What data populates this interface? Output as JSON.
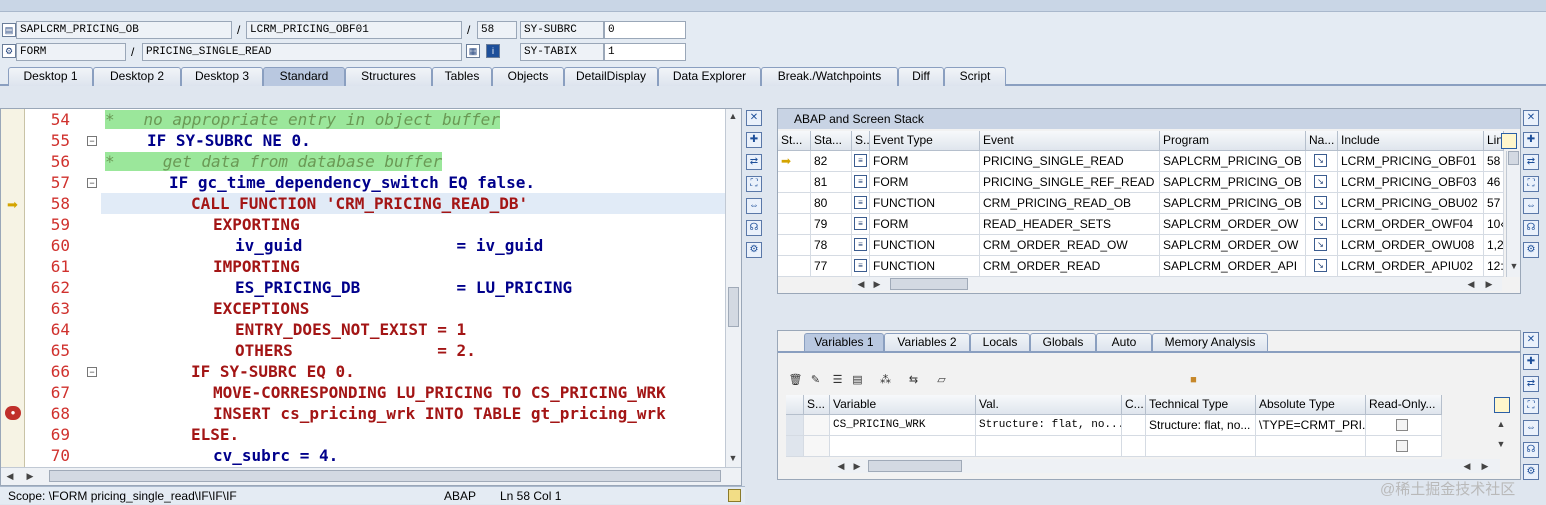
{
  "header": {
    "program": "SAPLCRM_PRICING_OB",
    "include": "LCRM_PRICING_OBF01",
    "line": "58",
    "subrc_label": "SY-SUBRC",
    "subrc_value": "0",
    "event_type": "FORM",
    "event": "PRICING_SINGLE_READ",
    "tabix_label": "SY-TABIX",
    "tabix_value": "1",
    "slash": "/"
  },
  "tabs": [
    "Desktop 1",
    "Desktop 2",
    "Desktop 3",
    "Standard",
    "Structures",
    "Tables",
    "Objects",
    "DetailDisplay",
    "Data Explorer",
    "Break./Watchpoints",
    "Diff",
    "Script"
  ],
  "editor": {
    "lines": [
      {
        "n": "54",
        "c": "*   no appropriate entry in object buffer"
      },
      {
        "n": "55",
        "c": "IF SY-SUBRC NE 0."
      },
      {
        "n": "56",
        "c": "*     get data from database buffer"
      },
      {
        "n": "57",
        "c": "IF gc_time_dependency_switch EQ false."
      },
      {
        "n": "58",
        "c": "CALL FUNCTION 'CRM_PRICING_READ_DB'"
      },
      {
        "n": "59",
        "c": "EXPORTING"
      },
      {
        "n": "60",
        "c": "iv_guid                = iv_guid"
      },
      {
        "n": "61",
        "c": "IMPORTING"
      },
      {
        "n": "62",
        "c": "ES_PRICING_DB          = LU_PRICING"
      },
      {
        "n": "63",
        "c": "EXCEPTIONS"
      },
      {
        "n": "64",
        "c": "ENTRY_DOES_NOT_EXIST = 1"
      },
      {
        "n": "65",
        "c": "OTHERS               = 2."
      },
      {
        "n": "66",
        "c": "IF SY-SUBRC EQ 0."
      },
      {
        "n": "67",
        "c": "MOVE-CORRESPONDING LU_PRICING TO CS_PRICING_WRK"
      },
      {
        "n": "68",
        "c": "INSERT cs_pricing_wrk INTO TABLE gt_pricing_wrk"
      },
      {
        "n": "69",
        "c": "ELSE."
      },
      {
        "n": "70",
        "c": "cv_subrc = 4."
      }
    ]
  },
  "status": {
    "scope": "Scope: \\FORM pricing_single_read\\IF\\IF\\IF",
    "lang": "ABAP",
    "pos": "Ln   58 Col   1"
  },
  "stack": {
    "title": "ABAP and Screen Stack",
    "columns": [
      "St...",
      "Sta...",
      "S..",
      "Event Type",
      "Event",
      "Program",
      "Na...",
      "Include",
      "Lin"
    ],
    "rows": [
      {
        "level": "82",
        "type": "FORM",
        "event": "PRICING_SINGLE_READ",
        "program": "SAPLCRM_PRICING_OB",
        "include": "LCRM_PRICING_OBF01",
        "line": "58",
        "current": true
      },
      {
        "level": "81",
        "type": "FORM",
        "event": "PRICING_SINGLE_REF_READ",
        "program": "SAPLCRM_PRICING_OB",
        "include": "LCRM_PRICING_OBF03",
        "line": "46",
        "current": false
      },
      {
        "level": "80",
        "type": "FUNCTION",
        "event": "CRM_PRICING_READ_OB",
        "program": "SAPLCRM_PRICING_OB",
        "include": "LCRM_PRICING_OBU02",
        "line": "57",
        "current": false
      },
      {
        "level": "79",
        "type": "FORM",
        "event": "READ_HEADER_SETS",
        "program": "SAPLCRM_ORDER_OW",
        "include": "LCRM_ORDER_OWF04",
        "line": "10‹",
        "current": false
      },
      {
        "level": "78",
        "type": "FUNCTION",
        "event": "CRM_ORDER_READ_OW",
        "program": "SAPLCRM_ORDER_OW",
        "include": "LCRM_ORDER_OWU08",
        "line": "1,2",
        "current": false
      },
      {
        "level": "77",
        "type": "FUNCTION",
        "event": "CRM_ORDER_READ",
        "program": "SAPLCRM_ORDER_API",
        "include": "LCRM_ORDER_APIU02",
        "line": "12:",
        "current": false
      }
    ]
  },
  "variables": {
    "tabs": [
      "Variables 1",
      "Variables 2",
      "Locals",
      "Globals",
      "Auto",
      "Memory Analysis"
    ],
    "columns": [
      "S...",
      "Variable",
      "Val.",
      "C...",
      "Technical Type",
      "Absolute Type",
      "Read-Only..."
    ],
    "rows": [
      {
        "variable": "CS_PRICING_WRK",
        "value": "Structure: flat, no...",
        "technical": "Structure: flat, no...",
        "absolute": "\\TYPE=CRMT_PRI..."
      }
    ]
  },
  "watermark": "@稀土掘金技术社区",
  "colors": {
    "accent": "#b9c8e0",
    "comment_bg": "#9be79b",
    "line_number": "#d0312d"
  }
}
